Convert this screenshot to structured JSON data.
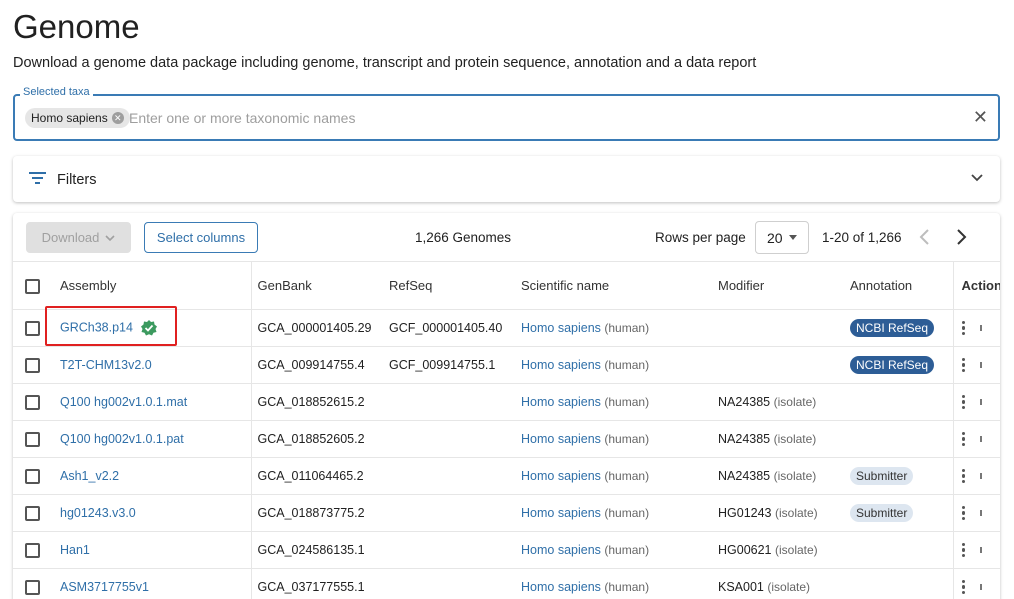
{
  "page": {
    "title": "Genome",
    "subtitle": "Download a genome data package including genome, transcript and protein sequence, annotation and a data report"
  },
  "taxa": {
    "legend": "Selected taxa",
    "chip": "Homo sapiens",
    "placeholder": "Enter one or more taxonomic names"
  },
  "filters": {
    "label": "Filters"
  },
  "toolbar": {
    "download_label": "Download",
    "select_columns_label": "Select columns",
    "genome_count": "1,266 Genomes",
    "rows_per_page_label": "Rows per page",
    "rows_per_page_value": "20",
    "range": "1-20 of 1,266"
  },
  "table": {
    "headers": {
      "assembly": "Assembly",
      "genbank": "GenBank",
      "refseq": "RefSeq",
      "scientific_name": "Scientific name",
      "modifier": "Modifier",
      "annotation": "Annotation",
      "actions": "Action."
    },
    "rows": [
      {
        "assembly": "GRCh38.p14",
        "genbank": "GCA_000001405.29",
        "refseq": "GCF_000001405.40",
        "sci": "Homo sapiens",
        "common": "(human)",
        "modifier": "",
        "modifier_type": "",
        "annotation": "NCBI RefSeq"
      },
      {
        "assembly": "T2T-CHM13v2.0",
        "genbank": "GCA_009914755.4",
        "refseq": "GCF_009914755.1",
        "sci": "Homo sapiens",
        "common": "(human)",
        "modifier": "",
        "modifier_type": "",
        "annotation": "NCBI RefSeq"
      },
      {
        "assembly": "Q100 hg002v1.0.1.mat",
        "genbank": "GCA_018852615.2",
        "refseq": "",
        "sci": "Homo sapiens",
        "common": "(human)",
        "modifier": "NA24385",
        "modifier_type": "(isolate)",
        "annotation": ""
      },
      {
        "assembly": "Q100 hg002v1.0.1.pat",
        "genbank": "GCA_018852605.2",
        "refseq": "",
        "sci": "Homo sapiens",
        "common": "(human)",
        "modifier": "NA24385",
        "modifier_type": "(isolate)",
        "annotation": ""
      },
      {
        "assembly": "Ash1_v2.2",
        "genbank": "GCA_011064465.2",
        "refseq": "",
        "sci": "Homo sapiens",
        "common": "(human)",
        "modifier": "NA24385",
        "modifier_type": "(isolate)",
        "annotation": "Submitter"
      },
      {
        "assembly": "hg01243.v3.0",
        "genbank": "GCA_018873775.2",
        "refseq": "",
        "sci": "Homo sapiens",
        "common": "(human)",
        "modifier": "HG01243",
        "modifier_type": "(isolate)",
        "annotation": "Submitter"
      },
      {
        "assembly": "Han1",
        "genbank": "GCA_024586135.1",
        "refseq": "",
        "sci": "Homo sapiens",
        "common": "(human)",
        "modifier": "HG00621",
        "modifier_type": "(isolate)",
        "annotation": ""
      },
      {
        "assembly": "ASM3717755v1",
        "genbank": "GCA_037177555.1",
        "refseq": "",
        "sci": "Homo sapiens",
        "common": "(human)",
        "modifier": "KSA001",
        "modifier_type": "(isolate)",
        "annotation": ""
      }
    ]
  },
  "colors": {
    "accent": "#3a7bb5",
    "link": "#2f6fa8",
    "badge_ncbi": "#2d5d96",
    "badge_submitter": "#dde6f0",
    "verified": "#3c9a5f",
    "highlight": "#e02020"
  },
  "icons": [
    "cancel-chip-icon",
    "close-icon",
    "filter-list-icon",
    "chevron-down-icon",
    "caret-down-icon",
    "chevron-left-icon",
    "chevron-right-icon",
    "verified-badge-icon",
    "more-vert-icon"
  ]
}
